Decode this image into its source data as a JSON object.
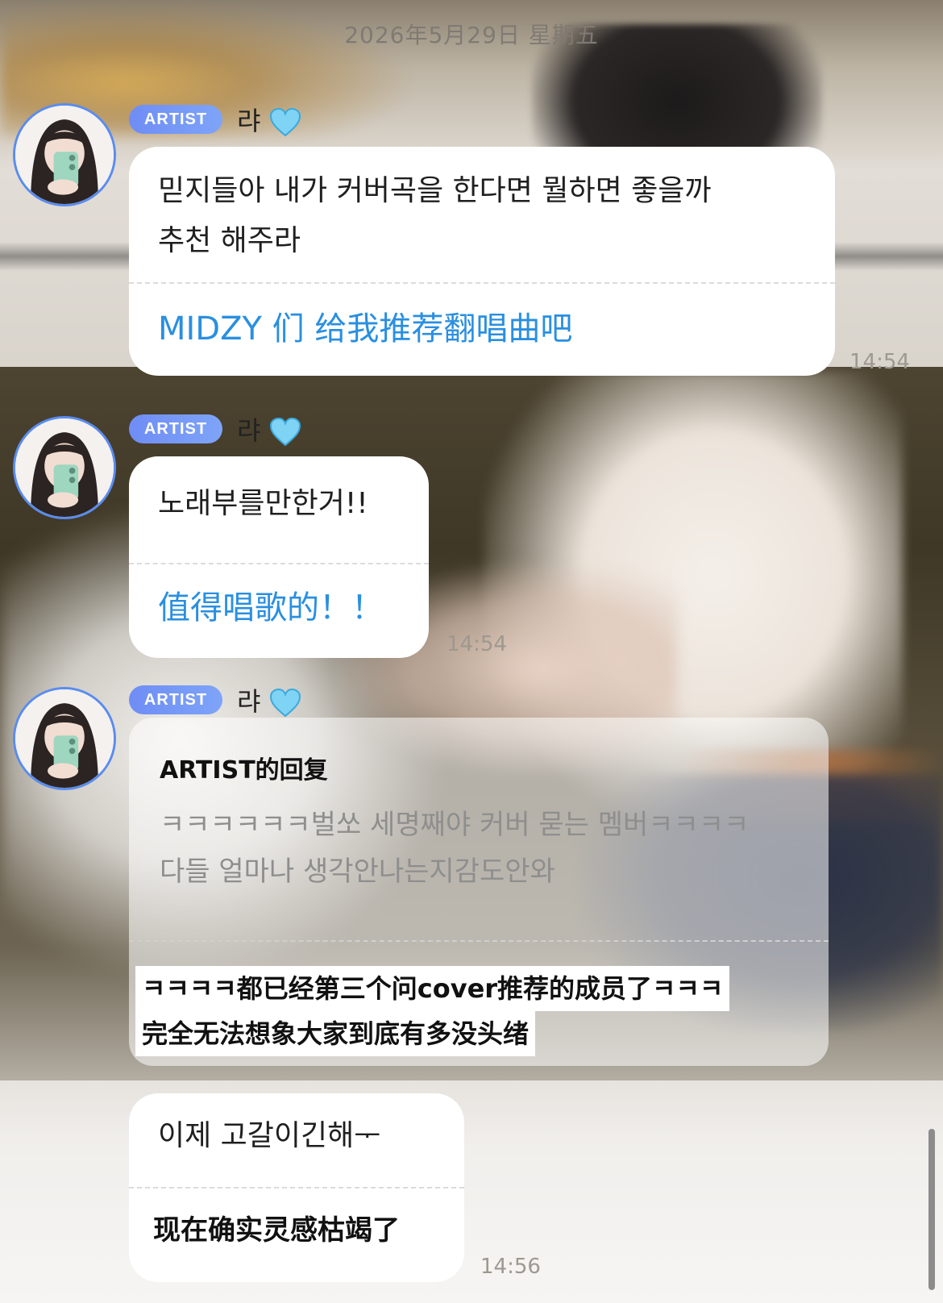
{
  "chat": {
    "date": "2026年5月29日 星期五",
    "badge": "ARTIST",
    "sender": "랴",
    "accent_color": "#5a8cf0",
    "translation_color": "#2a8fe0",
    "messages": [
      {
        "original_lines": [
          "믿지들아 내가 커버곡을 한다면 뭘하면 좋을까",
          "추천 해주라"
        ],
        "translation": "MIDZY 们 给我推荐翻唱曲吧",
        "time": "14:54"
      },
      {
        "original_lines": [
          "노래부를만한거!!"
        ],
        "translation": "值得唱歌的！！",
        "time": "14:54"
      }
    ],
    "reply": {
      "title": "ARTIST的回复",
      "quoted_lines": [
        "ㅋㅋㅋㅋㅋㅋ벌쏘 세명째야 커버 묻는 멤버ㅋㅋㅋㅋ",
        "다들 얼마나 생각안나는지감도안와"
      ],
      "translation_lines": [
        "ㅋㅋㅋㅋ都已经第三个问cover推荐的成员了ㅋㅋㅋ",
        "完全无法想象大家到底有多没头绪"
      ]
    },
    "last_message": {
      "original": "이제 고갈이긴해ᅮ",
      "translation": "现在确实灵感枯竭了",
      "time": "14:56"
    }
  },
  "icons": {
    "heart": "blue-heart-icon",
    "avatar": "profile-avatar"
  }
}
